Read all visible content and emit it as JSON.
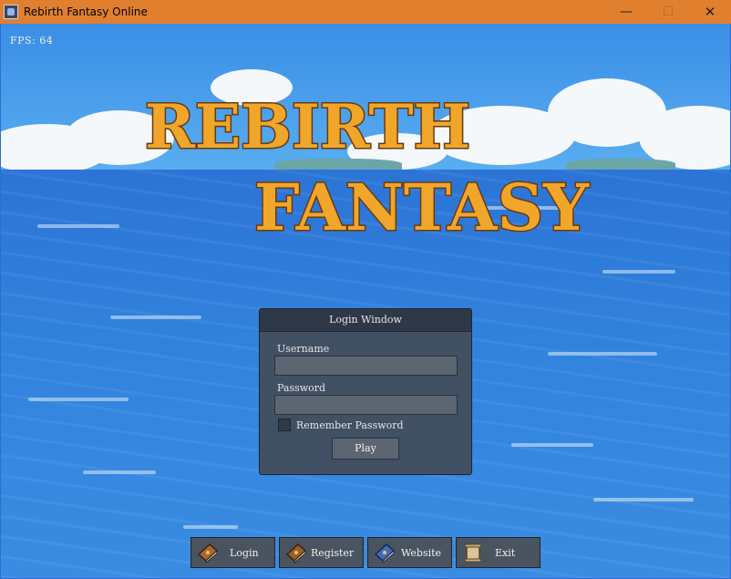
{
  "window": {
    "title": "Rebirth Fantasy Online",
    "minimize_glyph": "—",
    "maximize_glyph": "☐",
    "close_glyph": "✕"
  },
  "hud": {
    "fps": "FPS: 64"
  },
  "logo": {
    "line1": "REBIRTH",
    "line2": "FANTASY"
  },
  "login_window": {
    "title": "Login Window",
    "username_label": "Username",
    "username_value": "",
    "password_label": "Password",
    "password_value": "",
    "remember_label": "Remember Password",
    "remember_checked": false,
    "play_label": "Play"
  },
  "menu": [
    {
      "label": "Login",
      "icon": "book-brown-icon"
    },
    {
      "label": "Register",
      "icon": "book-brown-icon"
    },
    {
      "label": "Website",
      "icon": "book-blue-icon"
    },
    {
      "label": "Exit",
      "icon": "scroll-icon"
    }
  ],
  "colors": {
    "titlebar": "#e0802f",
    "panel": "#415063",
    "logo_fill": "#f0a62a",
    "logo_outline": "#6b3a10"
  }
}
